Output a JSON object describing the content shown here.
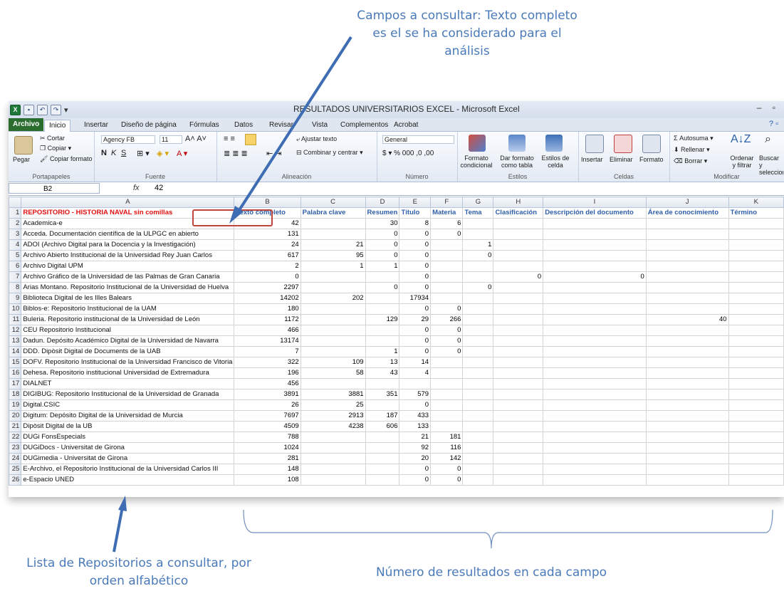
{
  "annotations": {
    "top": "Campos  a consultar: Texto completo es el se ha considerado para el análisis",
    "bottom_left": "Lista de Repositorios a consultar, por orden alfabético",
    "bottom_right": "Número de resultados en cada campo"
  },
  "window": {
    "title": "RESULTADOS UNIVERSITARIOS EXCEL - Microsoft Excel"
  },
  "tabs": [
    "Archivo",
    "Inicio",
    "Insertar",
    "Diseño de página",
    "Fórmulas",
    "Datos",
    "Revisar",
    "Vista",
    "Complementos",
    "Acrobat"
  ],
  "ribbon": {
    "portapapeles": {
      "paste": "Pegar",
      "cut": "Cortar",
      "copy": "Copiar",
      "format": "Copiar formato",
      "label": "Portapapeles"
    },
    "fuente": {
      "font": "Agency FB",
      "size": "11",
      "label": "Fuente"
    },
    "alineacion": {
      "wrap": "Ajustar texto",
      "merge": "Combinar y centrar",
      "label": "Alineación"
    },
    "numero": {
      "format": "General",
      "label": "Número"
    },
    "estilos": {
      "cond": "Formato condicional",
      "table": "Dar formato como tabla",
      "cell": "Estilos de celda",
      "label": "Estilos"
    },
    "celdas": {
      "insert": "Insertar",
      "delete": "Eliminar",
      "format": "Formato",
      "label": "Celdas"
    },
    "modificar": {
      "autosum": "Autosuma",
      "fill": "Rellenar",
      "clear": "Borrar",
      "sort": "Ordenar y filtrar",
      "find": "Buscar y seleccionar",
      "label": "Modificar"
    }
  },
  "formula_bar": {
    "cell": "B2",
    "fx": "fx",
    "value": "42"
  },
  "columns": [
    "A",
    "B",
    "C",
    "D",
    "E",
    "F",
    "G",
    "H",
    "I",
    "J",
    "K"
  ],
  "rows": [
    [
      "REPOSITORIO - HISTORIA NAVAL sin comillas",
      "Texto completo",
      "Palabra clave",
      "Resumen",
      "Título",
      "Materia",
      "Tema",
      "Clasificación",
      "Descripción del documento",
      "Área de conocimiento",
      "Término"
    ],
    [
      "Academica-e",
      "42",
      "",
      "30",
      "8",
      "6",
      "",
      "",
      "",
      "",
      ""
    ],
    [
      "Acceda. Documentación científica de la ULPGC en abierto",
      "131",
      "",
      "0",
      "0",
      "0",
      "",
      "",
      "",
      "",
      ""
    ],
    [
      "ADOI (Archivo Digital para la Docencia y la Investigación)",
      "24",
      "21",
      "0",
      "0",
      "",
      "1",
      "",
      "",
      "",
      ""
    ],
    [
      "Archivo Abierto Institucional de la Universidad Rey Juan Carlos",
      "617",
      "95",
      "0",
      "0",
      "",
      "0",
      "",
      "",
      "",
      ""
    ],
    [
      "Archivo Digital UPM",
      "2",
      "1",
      "1",
      "0",
      "",
      "",
      "",
      "",
      "",
      ""
    ],
    [
      "Archivo Gráfico de la Universidad de las Palmas de Gran Canaria",
      "0",
      "",
      "",
      "0",
      "",
      "",
      "0",
      "0",
      "",
      ""
    ],
    [
      "Arias Montano. Repositorio Institucional de la Universidad de Huelva",
      "2297",
      "",
      "0",
      "0",
      "",
      "0",
      "",
      "",
      "",
      ""
    ],
    [
      "Biblioteca Digital de les Illes Balears",
      "14202",
      "202",
      "",
      "17934",
      "",
      "",
      "",
      "",
      "",
      ""
    ],
    [
      "Biblos-e: Repositorio Institucional de la UAM",
      "180",
      "",
      "",
      "0",
      "0",
      "",
      "",
      "",
      "",
      ""
    ],
    [
      "Buleria. Repositorio institucional de la Universidad de León",
      "1172",
      "",
      "129",
      "29",
      "266",
      "",
      "",
      "",
      "40",
      ""
    ],
    [
      "CEU Repositorio Institucional",
      "466",
      "",
      "",
      "0",
      "0",
      "",
      "",
      "",
      "",
      ""
    ],
    [
      "Dadun. Depósito Académico Digital de la Universidad de Navarra",
      "13174",
      "",
      "",
      "0",
      "0",
      "",
      "",
      "",
      "",
      ""
    ],
    [
      "DDD. Dipòsit Digital de Documents de la UAB",
      "7",
      "",
      "1",
      "0",
      "0",
      "",
      "",
      "",
      "",
      ""
    ],
    [
      "DOFV. Repositorio Institucional de la Universidad Francisco de Vitoria",
      "322",
      "109",
      "13",
      "14",
      "",
      "",
      "",
      "",
      "",
      ""
    ],
    [
      "Dehesa. Repositorio institucional Universidad de Extremadura",
      "196",
      "58",
      "43",
      "4",
      "",
      "",
      "",
      "",
      "",
      ""
    ],
    [
      "DIALNET",
      "456",
      "",
      "",
      "",
      "",
      "",
      "",
      "",
      "",
      ""
    ],
    [
      "DIGIBUG: Repositorio Institucional de la Universidad de Granada",
      "3891",
      "3881",
      "351",
      "579",
      "",
      "",
      "",
      "",
      "",
      ""
    ],
    [
      "Digital.CSIC",
      "26",
      "25",
      "",
      "0",
      "",
      "",
      "",
      "",
      "",
      ""
    ],
    [
      "Digitum: Depósito Digital de la Universidad de Murcia",
      "7697",
      "2913",
      "187",
      "433",
      "",
      "",
      "",
      "",
      "",
      ""
    ],
    [
      "Dipòsit Digital de la UB",
      "4509",
      "4238",
      "606",
      "133",
      "",
      "",
      "",
      "",
      "",
      ""
    ],
    [
      "DUGi FonsEspecials",
      "788",
      "",
      "",
      "21",
      "181",
      "",
      "",
      "",
      "",
      ""
    ],
    [
      "DUGiDocs - Universitat de Girona",
      "1024",
      "",
      "",
      "92",
      "116",
      "",
      "",
      "",
      "",
      ""
    ],
    [
      "DUGimedia - Universitat de Girona",
      "281",
      "",
      "",
      "20",
      "142",
      "",
      "",
      "",
      "",
      ""
    ],
    [
      "E-Archivo, el Repositorio Institucional de la Universidad Carlos III",
      "148",
      "",
      "",
      "0",
      "0",
      "",
      "",
      "",
      "",
      ""
    ],
    [
      "e-Espacio UNED",
      "108",
      "",
      "",
      "0",
      "0",
      "",
      "",
      "",
      "",
      ""
    ]
  ]
}
